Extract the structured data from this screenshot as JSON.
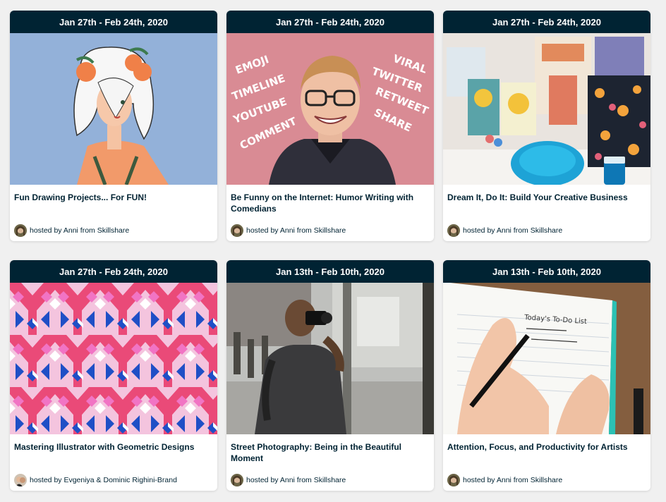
{
  "cards": [
    {
      "date": "Jan 27th - Feb 24th, 2020",
      "title": "Fun Drawing Projects... For FUN!",
      "host": "hosted by Anni from Skillshare",
      "thumb": "illustration-girl-with-oranges"
    },
    {
      "date": "Jan 27th - Feb 24th, 2020",
      "title": "Be Funny on the Internet: Humor Writing with Comedians",
      "host": "hosted by Anni from Skillshare",
      "thumb": "smiling-man-with-social-words",
      "thumb_words_left": [
        "EMOJI",
        "TIMELINE",
        "YOUTUBE",
        "COMMENT"
      ],
      "thumb_words_right": [
        "VIRAL",
        "TWITTER",
        "RETWEET",
        "SHARE"
      ]
    },
    {
      "date": "Jan 27th - Feb 24th, 2020",
      "title": "Dream It, Do It: Build Your Creative Business",
      "host": "hosted by Anni from Skillshare",
      "thumb": "craft-products-table"
    },
    {
      "date": "Jan 27th - Feb 24th, 2020",
      "title": "Mastering Illustrator with Geometric Designs",
      "host": "hosted by Evgeniya & Dominic Righini-Brand",
      "thumb": "geometric-pattern"
    },
    {
      "date": "Jan 13th - Feb 10th, 2020",
      "title": "Street Photography: Being in the Beautiful Moment",
      "host": "hosted by Anni from Skillshare",
      "thumb": "street-photographer"
    },
    {
      "date": "Jan 13th - Feb 10th, 2020",
      "title": "Attention, Focus, and Productivity for Artists",
      "host": "hosted by Anni from Skillshare",
      "thumb": "hand-writing-todo-list",
      "thumb_note_heading": "Today's To-Do List"
    }
  ],
  "colors": {
    "date_bar": "#002333",
    "background": "#f0f0f0",
    "title_text": "#002333"
  }
}
